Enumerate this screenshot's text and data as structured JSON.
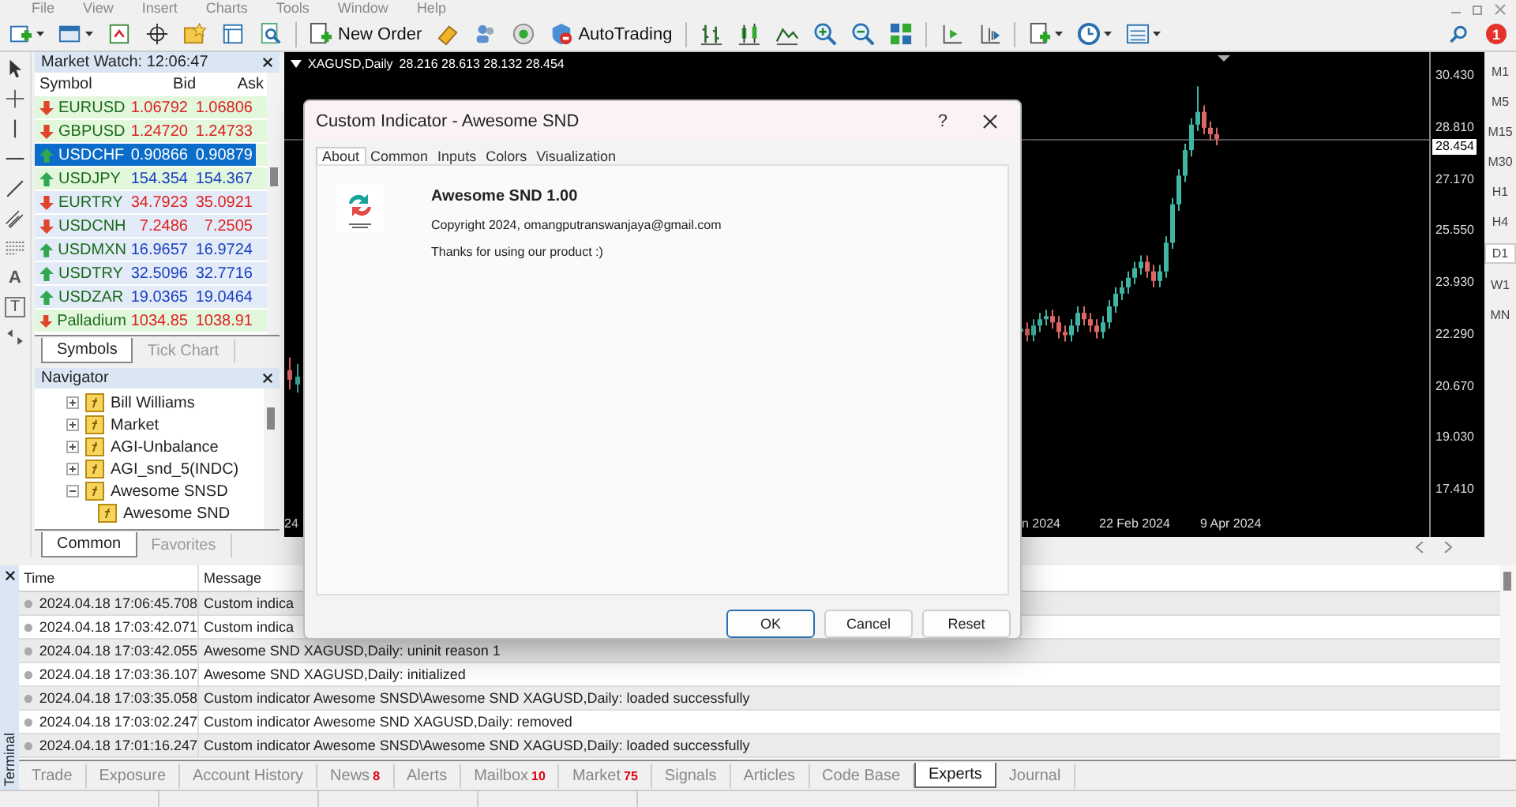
{
  "menu": [
    "File",
    "View",
    "Insert",
    "Charts",
    "Tools",
    "Window",
    "Help"
  ],
  "toolbar": {
    "new_order": "New Order",
    "auto_trading": "AutoTrading",
    "notifications": "1"
  },
  "drawing_tools": {
    "text_tool": "A",
    "label_tool": "T"
  },
  "market_watch": {
    "title": "Market Watch: 12:06:47",
    "columns": [
      "Symbol",
      "Bid",
      "Ask"
    ],
    "rows": [
      {
        "symbol": "EURUSD",
        "bid": "1.06792",
        "ask": "1.06806",
        "rising": false,
        "selected": false,
        "color": "#e2f7dc"
      },
      {
        "symbol": "GBPUSD",
        "bid": "1.24720",
        "ask": "1.24733",
        "rising": false,
        "selected": false,
        "color": "#e2f7dc"
      },
      {
        "symbol": "USDCHF",
        "bid": "0.90866",
        "ask": "0.90879",
        "rising": true,
        "selected": true,
        "color": "#e2f7dc"
      },
      {
        "symbol": "USDJPY",
        "bid": "154.354",
        "ask": "154.367",
        "rising": true,
        "selected": false,
        "color": "#e2f7dc"
      },
      {
        "symbol": "EURTRY",
        "bid": "34.7923",
        "ask": "35.0921",
        "rising": false,
        "selected": false,
        "color": "#e3ebf8"
      },
      {
        "symbol": "USDCNH",
        "bid": "7.2486",
        "ask": "7.2505",
        "rising": false,
        "selected": false,
        "color": "#e3ebf8"
      },
      {
        "symbol": "USDMXN",
        "bid": "16.9657",
        "ask": "16.9724",
        "rising": true,
        "selected": false,
        "color": "#e3ebf8"
      },
      {
        "symbol": "USDTRY",
        "bid": "32.5096",
        "ask": "32.7716",
        "rising": true,
        "selected": false,
        "color": "#e3ebf8"
      },
      {
        "symbol": "USDZAR",
        "bid": "19.0365",
        "ask": "19.0464",
        "rising": true,
        "selected": false,
        "color": "#e3ebf8"
      },
      {
        "symbol": "Palladium",
        "bid": "1034.85",
        "ask": "1038.91",
        "rising": false,
        "selected": false,
        "color": "#e2f7dc"
      }
    ],
    "tabs": [
      {
        "label": "Symbols",
        "selected": true
      },
      {
        "label": "Tick Chart",
        "selected": false
      }
    ]
  },
  "navigator": {
    "title": "Navigator",
    "items": [
      {
        "label": "Bill Williams",
        "expanded": false
      },
      {
        "label": "Market",
        "expanded": false
      },
      {
        "label": "AGI-Unbalance",
        "expanded": false
      },
      {
        "label": "AGI_snd_5(INDC)",
        "expanded": false
      },
      {
        "label": "Awesome SNSD",
        "expanded": true,
        "children": [
          {
            "label": "Awesome SND"
          }
        ]
      }
    ],
    "tabs": [
      {
        "label": "Common",
        "selected": true
      },
      {
        "label": "Favorites",
        "selected": false
      }
    ]
  },
  "chart": {
    "symbol": "XAGUSD,Daily",
    "ohlc": "28.216 28.613 28.132 28.454",
    "price_labels": [
      "30.430",
      "28.810",
      "27.170",
      "25.550",
      "23.930",
      "22.290",
      "20.670",
      "19.030",
      "17.410"
    ],
    "current_price": "28.454",
    "date_labels": [
      "24",
      "n 2024",
      "22 Feb 2024",
      "9 Apr 2024"
    ],
    "timeframes": [
      {
        "label": "M1",
        "selected": false
      },
      {
        "label": "M5",
        "selected": false
      },
      {
        "label": "M15",
        "selected": false
      },
      {
        "label": "M30",
        "selected": false
      },
      {
        "label": "H1",
        "selected": false
      },
      {
        "label": "H4",
        "selected": false
      },
      {
        "label": "D1",
        "selected": true
      },
      {
        "label": "W1",
        "selected": false
      },
      {
        "label": "MN",
        "selected": false
      }
    ]
  },
  "dialog": {
    "title": "Custom Indicator - Awesome SND",
    "help": "?",
    "tabs": [
      {
        "label": "About",
        "selected": true
      },
      {
        "label": "Common",
        "selected": false
      },
      {
        "label": "Inputs",
        "selected": false
      },
      {
        "label": "Colors",
        "selected": false
      },
      {
        "label": "Visualization",
        "selected": false
      }
    ],
    "name": "Awesome SND 1.00",
    "copyright": "Copyright 2024, omangputranswanjaya@gmail.com",
    "description": "Thanks for using our product :)",
    "buttons": [
      {
        "label": "OK",
        "default": true
      },
      {
        "label": "Cancel",
        "default": false
      },
      {
        "label": "Reset",
        "default": false
      }
    ]
  },
  "terminal": {
    "label": "Terminal",
    "columns": [
      "Time",
      "Message"
    ],
    "rows": [
      {
        "time": "2024.04.18 17:06:45.708",
        "message": "Custom indica"
      },
      {
        "time": "2024.04.18 17:03:42.071",
        "message": "Custom indica"
      },
      {
        "time": "2024.04.18 17:03:42.055",
        "message": "Awesome SND XAGUSD,Daily: uninit reason 1"
      },
      {
        "time": "2024.04.18 17:03:36.107",
        "message": "Awesome SND XAGUSD,Daily: initialized"
      },
      {
        "time": "2024.04.18 17:03:35.058",
        "message": "Custom indicator Awesome SNSD\\Awesome SND XAGUSD,Daily: loaded successfully"
      },
      {
        "time": "2024.04.18 17:03:02.247",
        "message": "Custom indicator Awesome SND XAGUSD,Daily: removed"
      },
      {
        "time": "2024.04.18 17:01:16.247",
        "message": "Custom indicator Awesome SNSD\\Awesome SND XAGUSD,Daily: loaded successfully"
      }
    ],
    "tabs": [
      {
        "label": "Trade",
        "selected": false
      },
      {
        "label": "Exposure",
        "selected": false
      },
      {
        "label": "Account History",
        "selected": false
      },
      {
        "label": "News",
        "badge": "8",
        "selected": false
      },
      {
        "label": "Alerts",
        "selected": false
      },
      {
        "label": "Mailbox",
        "badge": "10",
        "selected": false
      },
      {
        "label": "Market",
        "badge": "75",
        "selected": false
      },
      {
        "label": "Signals",
        "selected": false
      },
      {
        "label": "Articles",
        "selected": false
      },
      {
        "label": "Code Base",
        "selected": false
      },
      {
        "label": "Experts",
        "selected": true
      },
      {
        "label": "Journal",
        "selected": false
      }
    ]
  }
}
